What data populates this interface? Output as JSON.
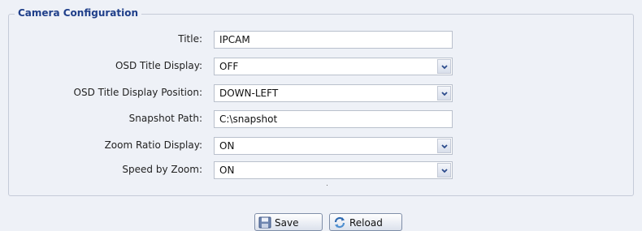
{
  "section": {
    "title": "Camera Configuration"
  },
  "form": {
    "title": {
      "label": "Title:",
      "value": "IPCAM"
    },
    "osd_title_display": {
      "label": "OSD Title Display:",
      "value": "OFF"
    },
    "osd_title_position": {
      "label": "OSD Title Display Position:",
      "value": "DOWN-LEFT"
    },
    "snapshot_path": {
      "label": "Snapshot Path:",
      "value": "C:\\snapshot"
    },
    "zoom_ratio_display": {
      "label": "Zoom Ratio Display:",
      "value": "ON"
    },
    "speed_by_zoom": {
      "label": "Speed by Zoom:",
      "value": "ON"
    }
  },
  "buttons": {
    "save": "Save",
    "reload": "Reload"
  },
  "icons": {
    "select_arrow": "chevron-down-icon",
    "save": "floppy-disk-icon",
    "reload": "refresh-icon"
  }
}
